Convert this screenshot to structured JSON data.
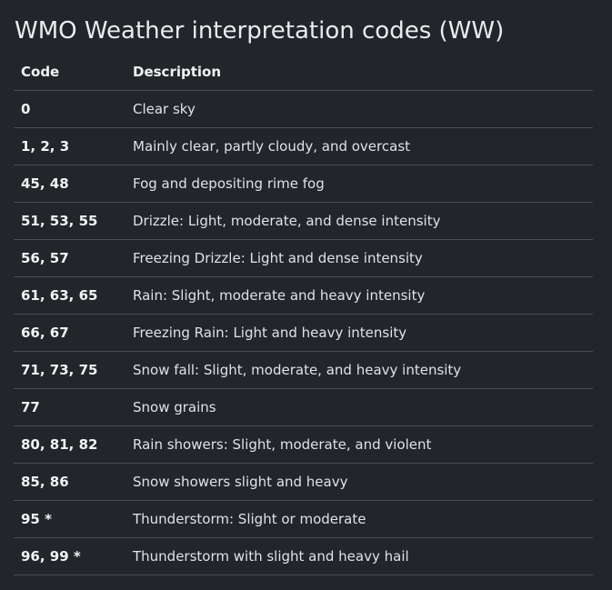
{
  "title": "WMO Weather interpretation codes (WW)",
  "table": {
    "headers": [
      "Code",
      "Description"
    ],
    "rows": [
      {
        "code": "0",
        "description": "Clear sky"
      },
      {
        "code": "1, 2, 3",
        "description": "Mainly clear, partly cloudy, and overcast"
      },
      {
        "code": "45, 48",
        "description": "Fog and depositing rime fog"
      },
      {
        "code": "51, 53, 55",
        "description": "Drizzle: Light, moderate, and dense intensity"
      },
      {
        "code": "56, 57",
        "description": "Freezing Drizzle: Light and dense intensity"
      },
      {
        "code": "61, 63, 65",
        "description": "Rain: Slight, moderate and heavy intensity"
      },
      {
        "code": "66, 67",
        "description": "Freezing Rain: Light and heavy intensity"
      },
      {
        "code": "71, 73, 75",
        "description": "Snow fall: Slight, moderate, and heavy intensity"
      },
      {
        "code": "77",
        "description": "Snow grains"
      },
      {
        "code": "80, 81, 82",
        "description": "Rain showers: Slight, moderate, and violent"
      },
      {
        "code": "85, 86",
        "description": "Snow showers slight and heavy"
      },
      {
        "code": "95 *",
        "description": "Thunderstorm: Slight or moderate"
      },
      {
        "code": "96, 99 *",
        "description": "Thunderstorm with slight and heavy hail"
      }
    ]
  }
}
